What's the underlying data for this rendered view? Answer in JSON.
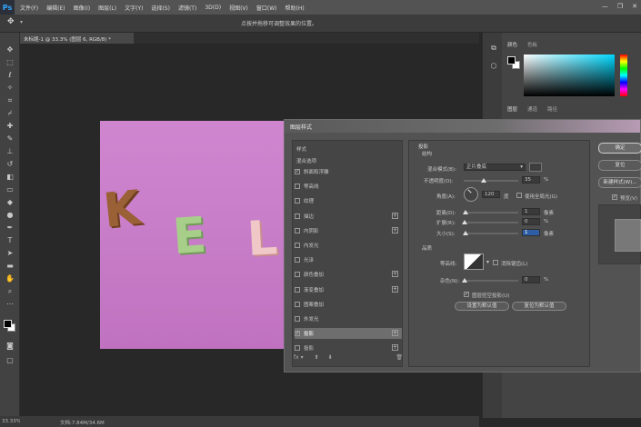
{
  "app": {
    "logo": "Ps",
    "window_controls": [
      "—",
      "❐",
      "✕"
    ]
  },
  "menu": [
    "文件(F)",
    "编辑(E)",
    "图像(I)",
    "图层(L)",
    "文字(Y)",
    "选择(S)",
    "滤镜(T)",
    "3D(D)",
    "视图(V)",
    "窗口(W)",
    "帮助(H)"
  ],
  "options_bar": {
    "hint": "点按并拖移可调整效果的位置。"
  },
  "document": {
    "tab_label": "未标题-1 @ 33.3% (图层 6, RGB/8) *",
    "zoom": "33.33%",
    "info": "文档:7.84M/34.6M",
    "artwork_letters": [
      "K",
      "E",
      "L"
    ]
  },
  "right_panel": {
    "color_tabs": [
      "颜色",
      "色板"
    ],
    "layer_tabs": [
      "图层",
      "通道",
      "路径"
    ]
  },
  "dialog": {
    "title": "图层样式",
    "styles_header": "样式",
    "blend_options": "混合选项",
    "styles": [
      {
        "label": "斜面和浮雕",
        "checked": true,
        "plus": false
      },
      {
        "label": "等高线",
        "checked": false,
        "plus": false
      },
      {
        "label": "纹理",
        "checked": false,
        "plus": false
      },
      {
        "label": "描边",
        "checked": false,
        "plus": true
      },
      {
        "label": "内阴影",
        "checked": false,
        "plus": true
      },
      {
        "label": "内发光",
        "checked": false,
        "plus": false
      },
      {
        "label": "光泽",
        "checked": false,
        "plus": false
      },
      {
        "label": "颜色叠加",
        "checked": false,
        "plus": true
      },
      {
        "label": "渐变叠加",
        "checked": false,
        "plus": true
      },
      {
        "label": "图案叠加",
        "checked": false,
        "plus": false
      },
      {
        "label": "外发光",
        "checked": false,
        "plus": false
      },
      {
        "label": "投影",
        "checked": true,
        "plus": true
      },
      {
        "label": "投影",
        "checked": false,
        "plus": true
      }
    ],
    "props": {
      "section_title": "投影",
      "structure": "结构",
      "blend_mode_label": "混合模式(B):",
      "blend_mode_value": "正片叠底",
      "opacity_label": "不透明度(O):",
      "opacity_value": "35",
      "angle_label": "角度(A):",
      "angle_value": "120",
      "angle_unit": "度",
      "global_light": "使用全局光(G)",
      "distance_label": "距离(D):",
      "distance_value": "1",
      "spread_label": "扩展(R):",
      "spread_value": "0",
      "size_label": "大小(S):",
      "size_value": "1",
      "px_unit": "像素",
      "pct_unit": "%",
      "quality": "品质",
      "contour_label": "等高线:",
      "antialias": "消除锯齿(L)",
      "noise_label": "杂色(N):",
      "noise_value": "0",
      "knockout": "图层挖空投影(U)",
      "make_default": "设置为默认值",
      "reset_default": "复位为默认值",
      "opacity_level": 0.35,
      "distance_level": 0.02,
      "spread_level": 0.0,
      "size_level": 0.02,
      "noise_level": 0.0
    },
    "buttons": {
      "ok": "确定",
      "reset": "复位",
      "new_style": "新建样式(W)...",
      "preview": "预览(V)"
    }
  }
}
